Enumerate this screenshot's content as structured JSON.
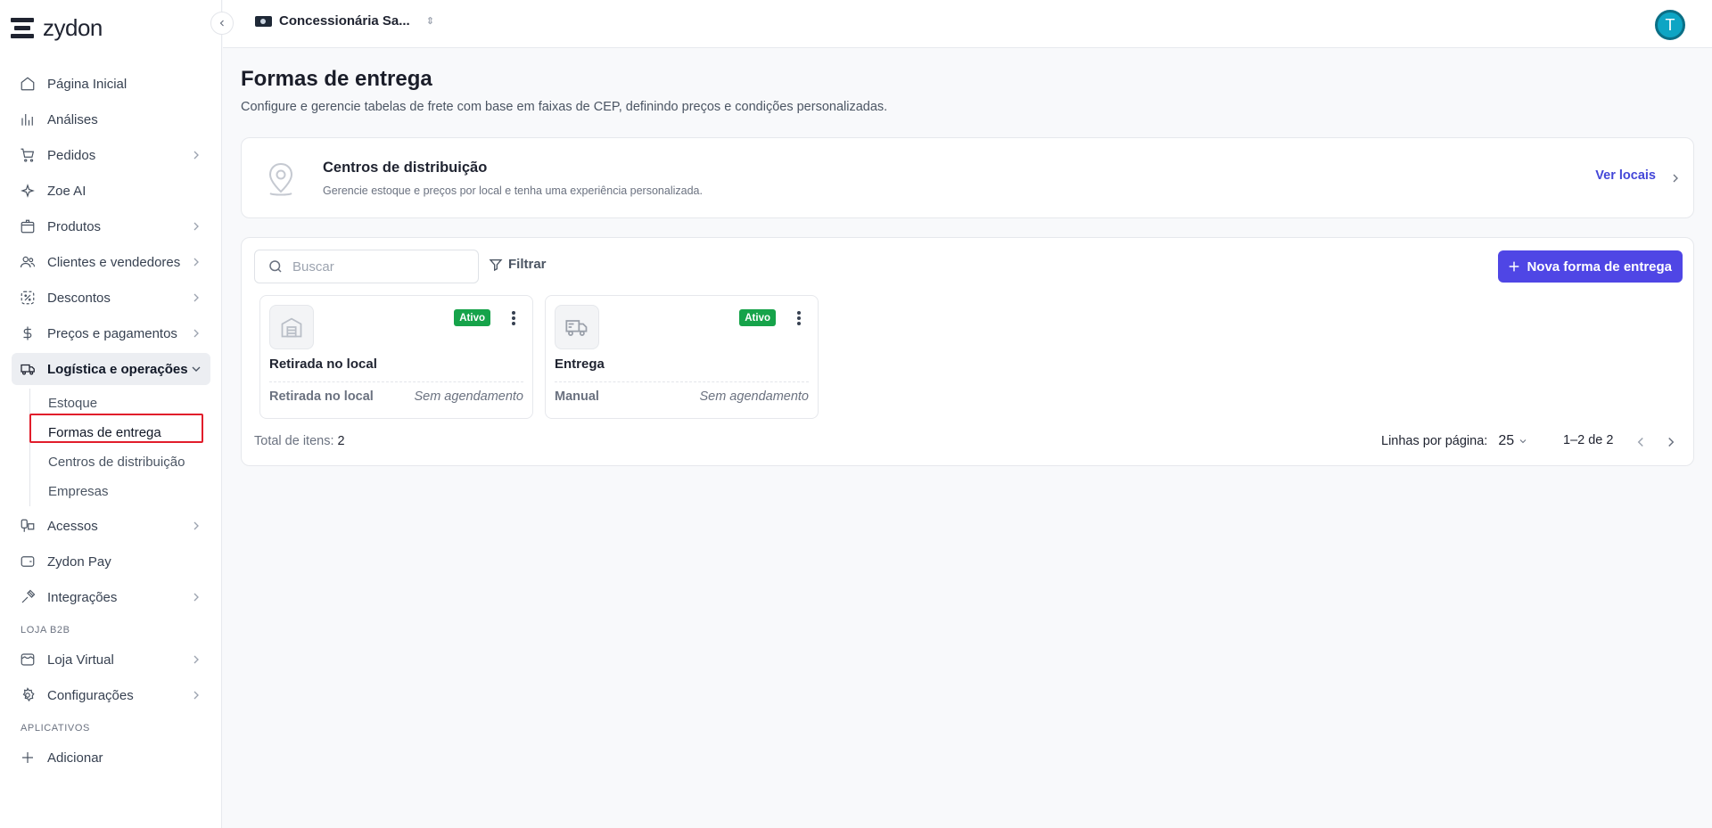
{
  "brand": {
    "name": "zydon"
  },
  "topbar": {
    "store_name": "Concessionária Sa...",
    "avatar_initial": "T"
  },
  "sidebar": {
    "items": [
      {
        "label": "Página Inicial",
        "icon": "home-icon"
      },
      {
        "label": "Análises",
        "icon": "chart-icon"
      },
      {
        "label": "Pedidos",
        "icon": "cart-icon"
      },
      {
        "label": "Zoe AI",
        "icon": "sparkles-icon"
      },
      {
        "label": "Produtos",
        "icon": "box-icon"
      },
      {
        "label": "Clientes e vendedores",
        "icon": "users-icon"
      },
      {
        "label": "Descontos",
        "icon": "discount-icon"
      },
      {
        "label": "Preços e pagamentos",
        "icon": "dollar-icon"
      },
      {
        "label": "Logística e operações",
        "icon": "truck-icon"
      }
    ],
    "logistics_sub": [
      {
        "label": "Estoque"
      },
      {
        "label": "Formas de entrega"
      },
      {
        "label": "Centros de distribuição"
      },
      {
        "label": "Empresas"
      }
    ],
    "items_after": [
      {
        "label": "Acessos",
        "icon": "key-icon"
      },
      {
        "label": "Zydon Pay",
        "icon": "wallet-icon"
      },
      {
        "label": "Integrações",
        "icon": "plug-icon"
      }
    ],
    "section_store": "LOJA B2B",
    "store_items": [
      {
        "label": "Loja Virtual",
        "icon": "store-icon"
      },
      {
        "label": "Configurações",
        "icon": "gear-icon"
      }
    ],
    "section_apps": "APLICATIVOS",
    "add_label": "Adicionar"
  },
  "page": {
    "title": "Formas de entrega",
    "description": "Configure e gerencie tabelas de frete com base em faixas de CEP, definindo preços e condições personalizadas."
  },
  "distribution_card": {
    "title": "Centros de distribuição",
    "subtitle": "Gerencie estoque e preços por local e tenha uma experiência personalizada.",
    "link_label": "Ver locais"
  },
  "toolbar": {
    "search_placeholder": "Buscar",
    "filter_label": "Filtrar",
    "new_button_label": "Nova forma de entrega"
  },
  "delivery_methods": [
    {
      "name": "Retirada no local",
      "status": "Ativo",
      "type": "Retirada no local",
      "scheduling": "Sem agendamento",
      "icon": "warehouse-icon"
    },
    {
      "name": "Entrega",
      "status": "Ativo",
      "type": "Manual",
      "scheduling": "Sem agendamento",
      "icon": "truck-icon"
    }
  ],
  "pagination": {
    "total_label": "Total de itens:",
    "total_value": "2",
    "rows_label": "Linhas por página:",
    "rows_value": "25",
    "range": "1–2 de 2"
  },
  "colors": {
    "accent": "#4f46e5",
    "active_badge": "#16a34a",
    "highlight": "#e11d2b"
  }
}
